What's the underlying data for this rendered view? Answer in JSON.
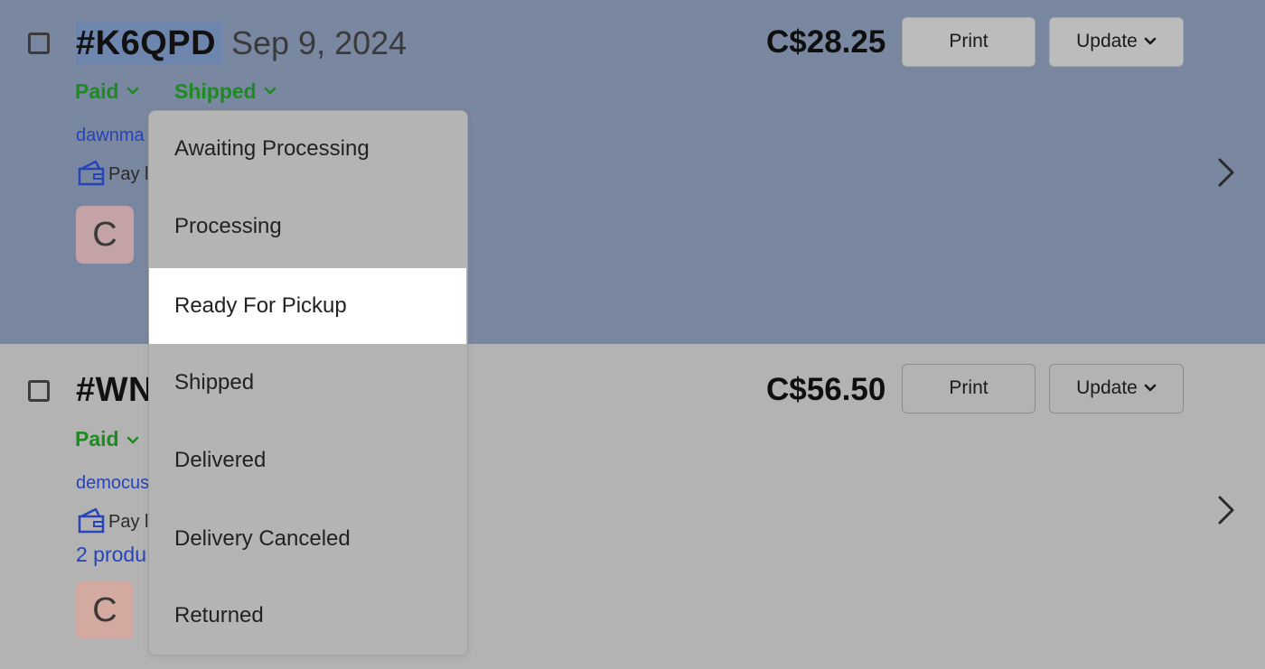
{
  "orders": [
    {
      "id": "#K6QPD",
      "date": "Sep 9, 2024",
      "payment_status": "Paid",
      "shipping_status": "Shipped",
      "customer": "dawnma",
      "payment_method": "Pay l",
      "avatar_letter": "C",
      "price": "C$28.25",
      "print_label": "Print",
      "update_label": "Update"
    },
    {
      "id": "#WN",
      "payment_status": "Paid",
      "customer": "democus",
      "payment_method": "Pay l",
      "products": "2 produ",
      "avatar_letter": "C",
      "price": "C$56.50",
      "print_label": "Print",
      "update_label": "Update"
    }
  ],
  "status_dropdown": {
    "options": [
      "Awaiting Processing",
      "Processing",
      "Ready For Pickup",
      "Shipped",
      "Delivered",
      "Delivery Canceled",
      "Returned"
    ],
    "highlighted": "Ready For Pickup"
  },
  "colors": {
    "selected_row_bg": "#7a87a1",
    "status_green": "#1f8a22",
    "link_blue": "#2743b8",
    "dropdown_bg": "#b4b4b4"
  },
  "icons": {
    "chevron": "chevron-down-icon",
    "wallet": "wallet-icon",
    "row_arrow": "chevron-right-icon"
  }
}
